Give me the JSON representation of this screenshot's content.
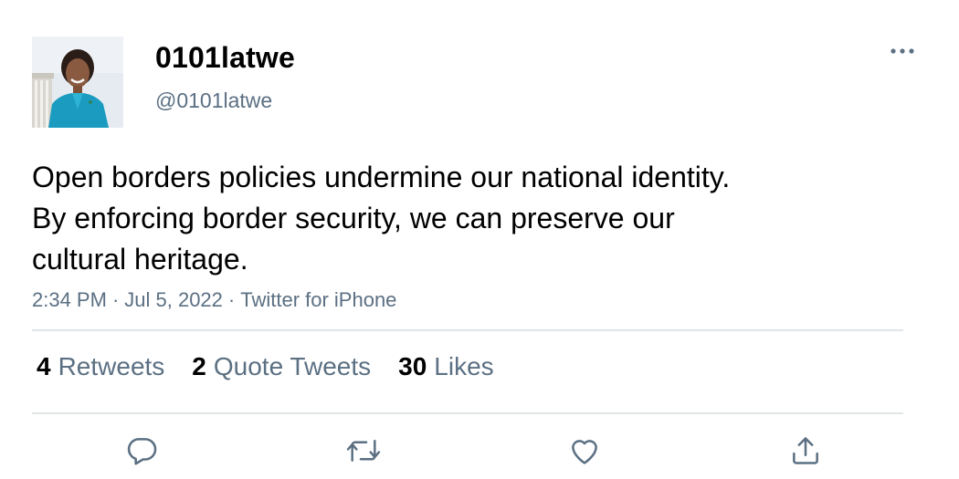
{
  "user": {
    "display_name": "0101latwe",
    "handle": "@0101latwe",
    "avatar_icon": "avatar-photo"
  },
  "tweet": {
    "lines": [
      "Open borders policies undermine our national identity.",
      "By enforcing border security, we can preserve our",
      "cultural heritage."
    ],
    "time": "2:34 PM",
    "date": "Jul 5, 2022",
    "source": "Twitter for iPhone",
    "separator": "·"
  },
  "stats": {
    "retweets_count": "4",
    "retweets_label": "Retweets",
    "quotes_count": "2",
    "quotes_label": "Quote Tweets",
    "likes_count": "30",
    "likes_label": "Likes"
  },
  "icons": {
    "more": "more-horizontal-icon",
    "reply": "reply-icon",
    "retweet": "retweet-icon",
    "like": "heart-icon",
    "share": "share-icon"
  },
  "colors": {
    "text_primary": "#000000",
    "text_secondary": "#5b7083",
    "divider": "#e1e5e8",
    "icon": "#5b7083"
  }
}
